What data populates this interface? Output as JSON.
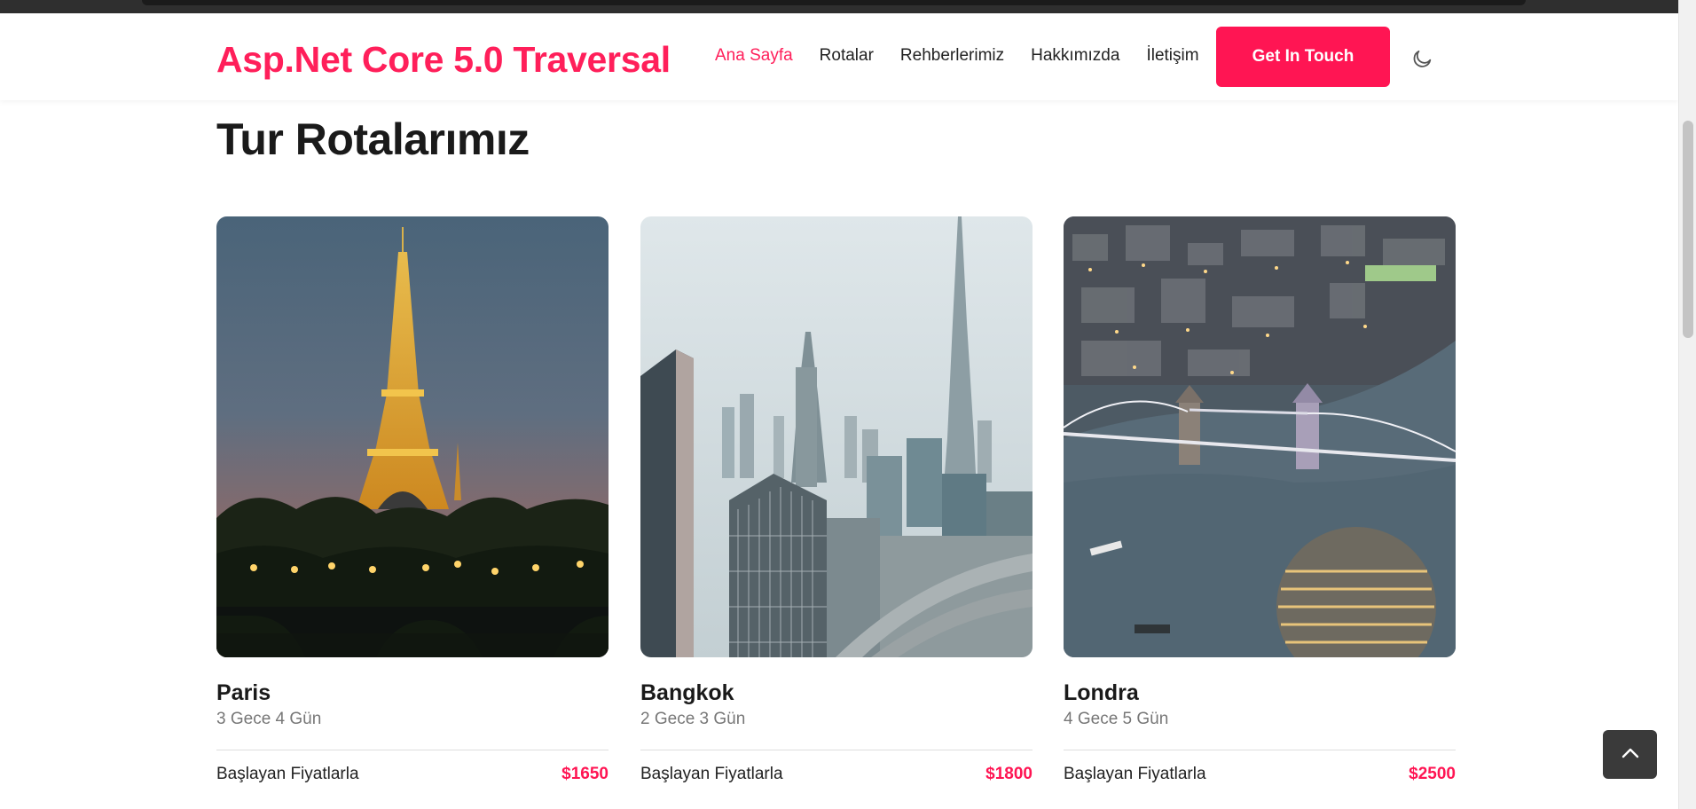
{
  "header": {
    "brand": "Asp.Net Core 5.0 Traversal",
    "menu": [
      {
        "label": "Ana Sayfa",
        "active": true
      },
      {
        "label": "Rotalar",
        "active": false
      },
      {
        "label": "Rehberlerimiz",
        "active": false
      },
      {
        "label": "Hakkımızda",
        "active": false
      },
      {
        "label": "İletişim",
        "active": false
      }
    ],
    "cta_label": "Get In Touch",
    "theme_toggle_icon": "moon-icon"
  },
  "section": {
    "title": "Tur Rotalarımız"
  },
  "routes": [
    {
      "city": "Paris",
      "duration": "3 Gece 4 Gün",
      "price_label": "Başlayan Fiyatlarla",
      "price": "$1650",
      "image": "eiffel-tower-night-image"
    },
    {
      "city": "Bangkok",
      "duration": "2 Gece 3 Gün",
      "price_label": "Başlayan Fiyatlarla",
      "price": "$1800",
      "image": "city-skyscrapers-image"
    },
    {
      "city": "Londra",
      "duration": "4 Gece 5 Gün",
      "price_label": "Başlayan Fiyatlarla",
      "price": "$2500",
      "image": "tower-bridge-aerial-image"
    }
  ],
  "back_to_top_icon": "chevron-up-icon",
  "colors": {
    "accent": "#ff1553",
    "brand": "#ff1f5a"
  }
}
